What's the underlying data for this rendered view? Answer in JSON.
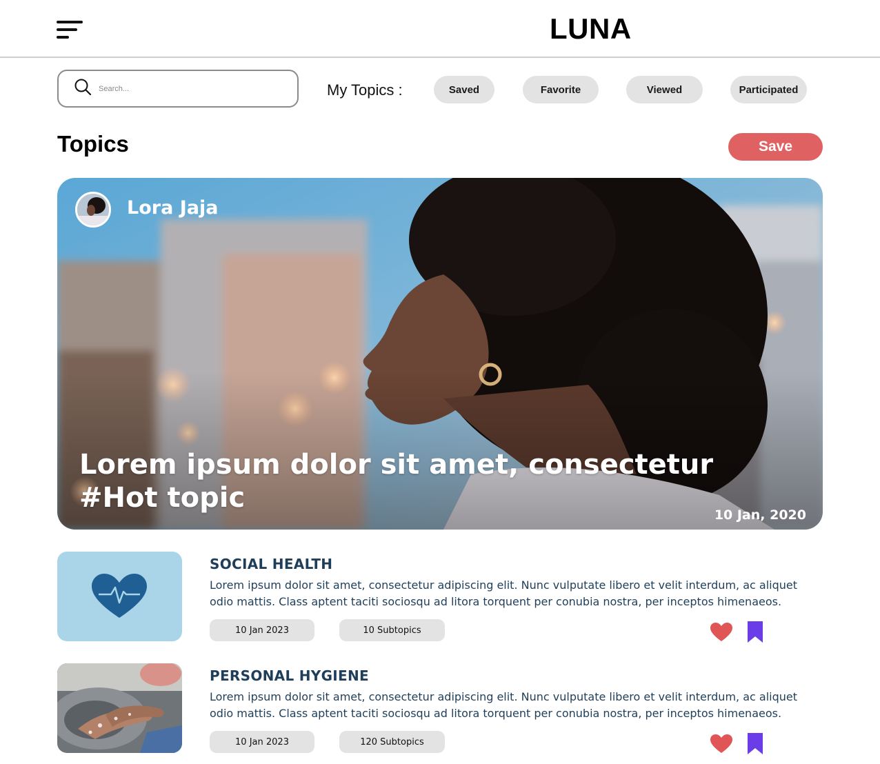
{
  "app": {
    "logo": "LUNA"
  },
  "search": {
    "placeholder": "Search..."
  },
  "my_topics": {
    "label": "My Topics :",
    "chips": [
      "Saved",
      "Favorite",
      "Viewed",
      "Participated"
    ]
  },
  "section": {
    "title": "Topics",
    "save_label": "Save"
  },
  "hero": {
    "author": "Lora Jaja",
    "headline_line1": "Lorem ipsum dolor sit amet, consectetur",
    "headline_line2": "#Hot topic",
    "date": "10 Jan, 2020"
  },
  "topics": [
    {
      "title": "SOCIAL HEALTH",
      "description": "Lorem ipsum dolor sit amet, consectetur adipiscing elit. Nunc vulputate libero et velit interdum, ac aliquet odio mattis. Class aptent taciti sociosqu ad litora torquent per conubia nostra, per inceptos himenaeos.",
      "date": "10 Jan 2023",
      "subtopics": "10 Subtopics",
      "thumb_icon": "heart-pulse-icon"
    },
    {
      "title": "PERSONAL HYGIENE",
      "description": "Lorem ipsum dolor sit amet, consectetur adipiscing elit. Nunc vulputate libero et velit interdum, ac aliquet odio mattis. Class aptent taciti sociosqu ad litora torquent per conubia nostra, per inceptos himenaeos.",
      "date": "10 Jan 2023",
      "subtopics": "120 Subtopics",
      "thumb_icon": "hand-washing-photo"
    }
  ],
  "colors": {
    "accent_save": "#e06161",
    "title_blue": "#1f3e5a",
    "heart": "#e05555",
    "bookmark": "#6a3de8",
    "chip_bg": "#e3e3e3"
  }
}
